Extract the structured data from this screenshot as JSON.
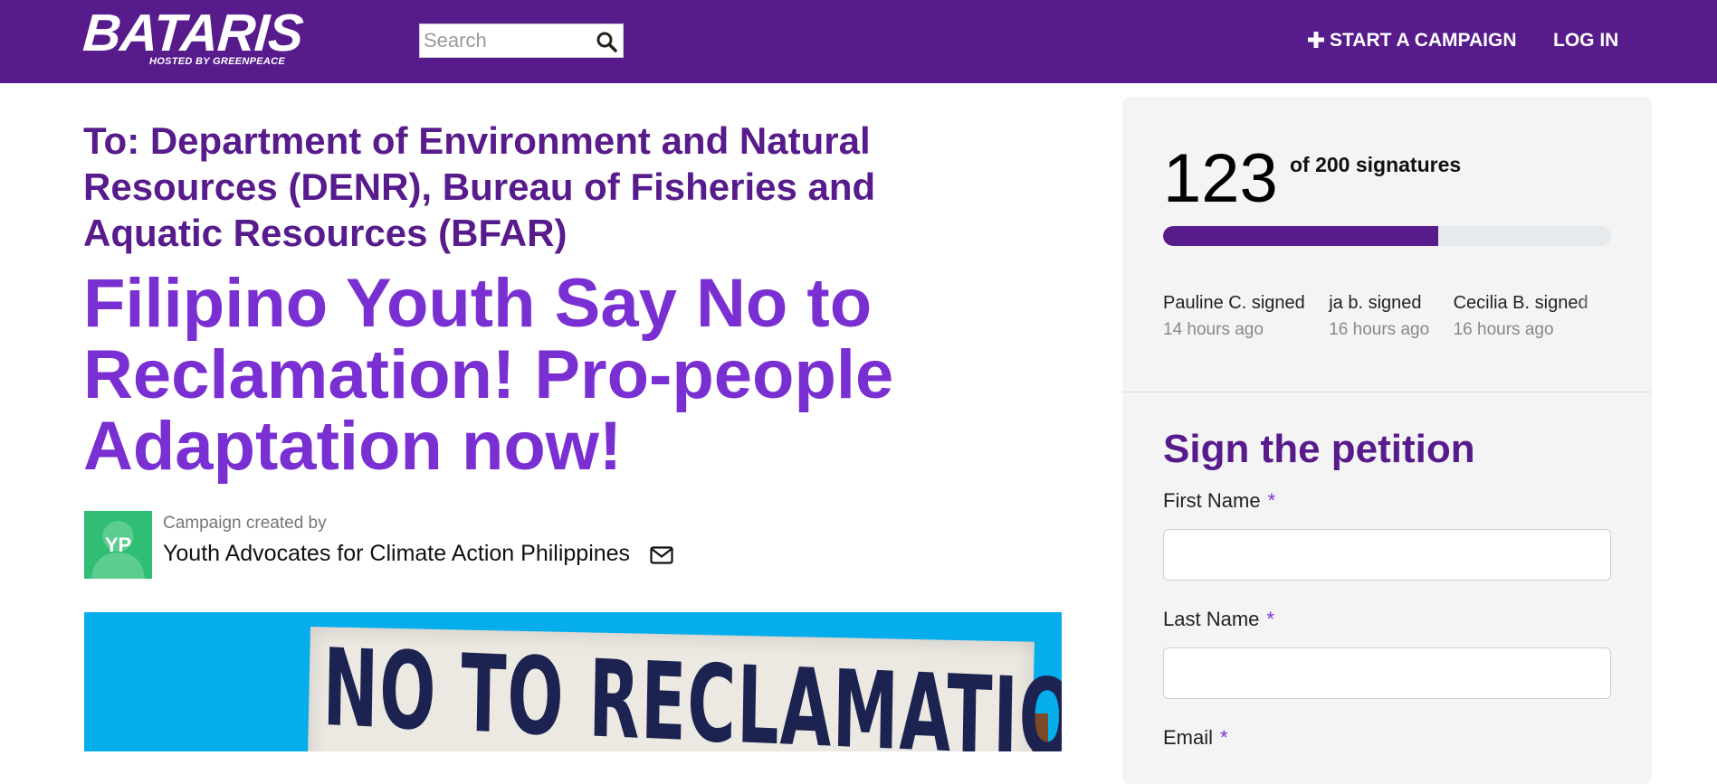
{
  "header": {
    "logo_text": "BATARIS",
    "logo_subtext": "HOSTED BY GREENPEACE",
    "search_placeholder": "Search",
    "start_campaign": "START A CAMPAIGN",
    "login": "LOG IN",
    "colors": {
      "bar": "#571b8c",
      "text": "#ffffff"
    }
  },
  "petition": {
    "to": "To: Department of Environment and Natural Resources (DENR), Bureau of Fisheries and Aquatic Resources (BFAR)",
    "title": "Filipino Youth Say No to Reclamation! Pro-people Adaptation now!",
    "creator": {
      "label": "Campaign created by",
      "name": "Youth Advocates for Climate Action Philippines",
      "initials": "YP",
      "avatar_color": "#2fbe73"
    },
    "hero_image_text": "NO TO RECLAMATION"
  },
  "signatures": {
    "count": "123",
    "goal_text": "of 200 signatures",
    "progress_fraction": 0.615,
    "recent": [
      {
        "name": "Pauline C. signed",
        "time": "14 hours ago"
      },
      {
        "name": "ja b. signed",
        "time": "16 hours ago"
      },
      {
        "name": "Cecilia B. signed",
        "time": "16 hours ago"
      }
    ]
  },
  "form": {
    "title": "Sign the petition",
    "required_marker": "*",
    "fields": [
      {
        "label": "First Name",
        "value": ""
      },
      {
        "label": "Last Name",
        "value": ""
      },
      {
        "label": "Email",
        "value": ""
      }
    ]
  },
  "colors": {
    "accent_dark": "#571b8c",
    "accent_bright": "#7a2fd3",
    "panel_bg": "#f4f4f4",
    "hero_bg": "#05adeb"
  }
}
